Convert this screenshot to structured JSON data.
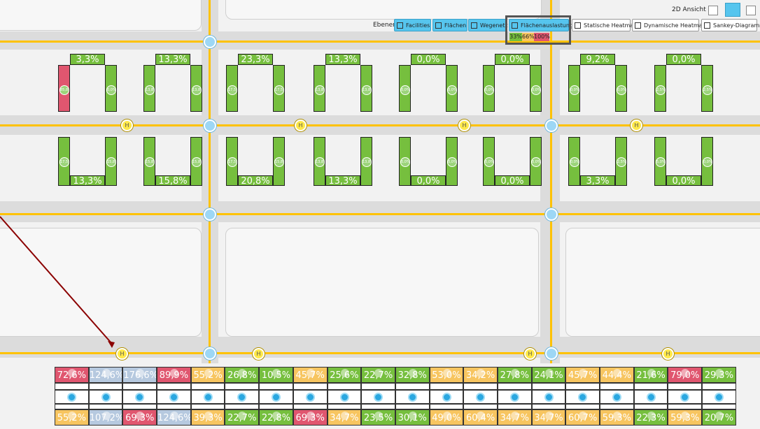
{
  "toolbar": {
    "view_label": "2D Ansicht",
    "layers_label": "Ebenen",
    "buttons": [
      {
        "label": "Facilities",
        "active": true
      },
      {
        "label": "Flächen",
        "active": true
      },
      {
        "label": "Wegenetz",
        "active": true
      },
      {
        "label": "Flächenauslastung",
        "active": true
      },
      {
        "label": "Statische Heatmap",
        "active": false
      },
      {
        "label": "Dynamische Heatmap",
        "active": false
      },
      {
        "label": "Sankey-Diagramm",
        "active": false
      }
    ],
    "legend": [
      {
        "label": "33%",
        "color": "#76bf3e"
      },
      {
        "label": "66%",
        "color": "#f7c560"
      },
      {
        "label": "100%",
        "color": "#e0566f"
      }
    ]
  },
  "top_areas": [
    {
      "value": "3,3%",
      "left_alert": true,
      "left_value": "85,8%",
      "right_value": "0,0%"
    },
    {
      "value": "13,3%",
      "left_value": "13,8%",
      "right_value": "13,8%"
    },
    {
      "value": "23,3%",
      "left_value": "17,5%",
      "right_value": "17,5%"
    },
    {
      "value": "13,3%",
      "left_value": "13,8%",
      "right_value": "13,8%"
    },
    {
      "value": "0,0%",
      "left_value": "0,0%",
      "right_value": "0,0%"
    },
    {
      "value": "0,0%",
      "left_value": "0,0%",
      "right_value": "0,0%"
    },
    {
      "value": "9,2%",
      "left_value": "0,0%",
      "right_value": "0,0%"
    },
    {
      "value": "0,0%",
      "left_value": "2,5%",
      "right_value": "2,5%"
    }
  ],
  "bottom_areas": [
    {
      "value": "13,3%",
      "left_value": "17,5%",
      "right_value": "15,8%"
    },
    {
      "value": "15,8%",
      "left_value": "15,8%",
      "right_value": "15,8%"
    },
    {
      "value": "20,8%",
      "left_value": "17,5%",
      "right_value": "15,8%"
    },
    {
      "value": "13,3%",
      "left_value": "13,8%",
      "right_value": "13,8%"
    },
    {
      "value": "0,0%",
      "left_value": "0,0%",
      "right_value": "0,0%"
    },
    {
      "value": "0,0%",
      "left_value": "0,0%",
      "right_value": "0,0%"
    },
    {
      "value": "3,3%",
      "left_value": "0,0%",
      "right_value": "2,5%"
    },
    {
      "value": "0,0%",
      "left_value": "5,0%",
      "right_value": "0,0%"
    }
  ],
  "hub_label": "H",
  "bottom_row_top": [
    {
      "v": "72,6%",
      "c": "#e0566f"
    },
    {
      "v": "124,6%",
      "c": "#b6c9df"
    },
    {
      "v": "176,6%",
      "c": "#b6c9df"
    },
    {
      "v": "89,9%",
      "c": "#e0566f"
    },
    {
      "v": "55,2%",
      "c": "#f7c560"
    },
    {
      "v": "26,8%",
      "c": "#76bf3e"
    },
    {
      "v": "10,5%",
      "c": "#76bf3e"
    },
    {
      "v": "45,7%",
      "c": "#f7c560"
    },
    {
      "v": "25,6%",
      "c": "#76bf3e"
    },
    {
      "v": "22,7%",
      "c": "#76bf3e"
    },
    {
      "v": "32,8%",
      "c": "#76bf3e"
    },
    {
      "v": "53,0%",
      "c": "#f7c560"
    },
    {
      "v": "34,2%",
      "c": "#f7c560"
    },
    {
      "v": "27,8%",
      "c": "#76bf3e"
    },
    {
      "v": "24,1%",
      "c": "#76bf3e"
    },
    {
      "v": "45,7%",
      "c": "#f7c560"
    },
    {
      "v": "44,4%",
      "c": "#f7c560"
    },
    {
      "v": "21,6%",
      "c": "#76bf3e"
    },
    {
      "v": "79,0%",
      "c": "#e0566f"
    },
    {
      "v": "29,3%",
      "c": "#76bf3e"
    }
  ],
  "bottom_row_bottom": [
    {
      "v": "55,2%",
      "c": "#f7c560"
    },
    {
      "v": "107,2%",
      "c": "#b6c9df"
    },
    {
      "v": "69,3%",
      "c": "#e0566f"
    },
    {
      "v": "124,6%",
      "c": "#b6c9df"
    },
    {
      "v": "39,3%",
      "c": "#f7c560"
    },
    {
      "v": "22,7%",
      "c": "#76bf3e"
    },
    {
      "v": "22,8%",
      "c": "#76bf3e"
    },
    {
      "v": "69,3%",
      "c": "#e0566f"
    },
    {
      "v": "34,7%",
      "c": "#f7c560"
    },
    {
      "v": "23,5%",
      "c": "#76bf3e"
    },
    {
      "v": "30,1%",
      "c": "#76bf3e"
    },
    {
      "v": "49,0%",
      "c": "#f7c560"
    },
    {
      "v": "60,4%",
      "c": "#f7c560"
    },
    {
      "v": "34,7%",
      "c": "#f7c560"
    },
    {
      "v": "34,7%",
      "c": "#f7c560"
    },
    {
      "v": "60,7%",
      "c": "#f7c560"
    },
    {
      "v": "59,3%",
      "c": "#f7c560"
    },
    {
      "v": "22,3%",
      "c": "#76bf3e"
    },
    {
      "v": "59,3%",
      "c": "#f7c560"
    },
    {
      "v": "20,7%",
      "c": "#76bf3e"
    }
  ]
}
